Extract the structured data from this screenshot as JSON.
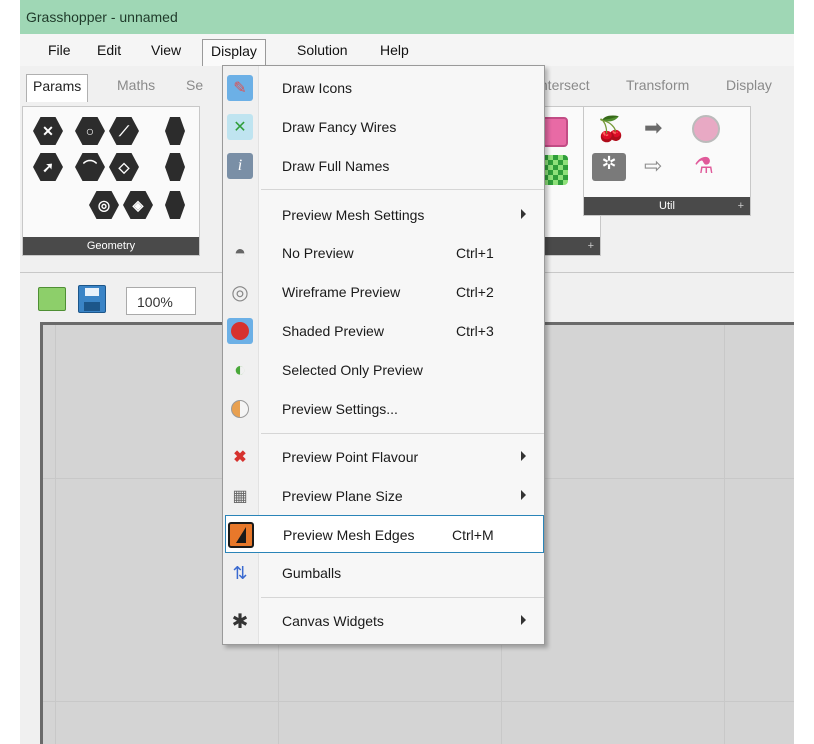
{
  "window": {
    "title": "Grasshopper - unnamed"
  },
  "menubar": {
    "items": [
      {
        "label": "File"
      },
      {
        "label": "Edit"
      },
      {
        "label": "View"
      },
      {
        "label": "Display"
      },
      {
        "label": "Solution"
      },
      {
        "label": "Help"
      }
    ]
  },
  "tabs": [
    {
      "label": "Params"
    },
    {
      "label": "Maths"
    },
    {
      "label": "Se"
    },
    {
      "label": "Intersect"
    },
    {
      "label": "Transform"
    },
    {
      "label": "Display"
    }
  ],
  "panels": {
    "geometry": {
      "label": "Geometry"
    },
    "util": {
      "label": "Util"
    }
  },
  "canvas_toolbar": {
    "zoom": "100%"
  },
  "display_menu": {
    "items": [
      {
        "label": "Draw Icons",
        "shortcut": "",
        "icon": "draw-icons-icon"
      },
      {
        "label": "Draw Fancy Wires",
        "shortcut": "",
        "icon": "fancy-wires-icon"
      },
      {
        "label": "Draw Full Names",
        "shortcut": "",
        "icon": "info-icon"
      },
      {
        "label": "Preview Mesh Settings",
        "shortcut": "",
        "icon": "",
        "submenu": true
      },
      {
        "label": "No Preview",
        "shortcut": "Ctrl+1",
        "icon": "no-preview-icon"
      },
      {
        "label": "Wireframe Preview",
        "shortcut": "Ctrl+2",
        "icon": "wireframe-preview-icon"
      },
      {
        "label": "Shaded Preview",
        "shortcut": "Ctrl+3",
        "icon": "shaded-preview-icon"
      },
      {
        "label": "Selected Only Preview",
        "shortcut": "",
        "icon": "selected-only-preview-icon"
      },
      {
        "label": "Preview Settings...",
        "shortcut": "",
        "icon": "preview-settings-icon"
      },
      {
        "label": "Preview Point Flavour",
        "shortcut": "",
        "icon": "point-flavour-icon",
        "submenu": true
      },
      {
        "label": "Preview Plane Size",
        "shortcut": "",
        "icon": "plane-size-icon",
        "submenu": true
      },
      {
        "label": "Preview Mesh Edges",
        "shortcut": "Ctrl+M",
        "icon": "mesh-edges-icon",
        "highlighted": true
      },
      {
        "label": "Gumballs",
        "shortcut": "",
        "icon": "gumball-icon"
      },
      {
        "label": "Canvas Widgets",
        "shortcut": "",
        "icon": "canvas-widgets-icon",
        "submenu": true
      }
    ]
  },
  "colors": {
    "titlebar": "#9fd7b5",
    "highlight_border": "#2a84b8",
    "panel_footer": "#4a4a4a"
  }
}
